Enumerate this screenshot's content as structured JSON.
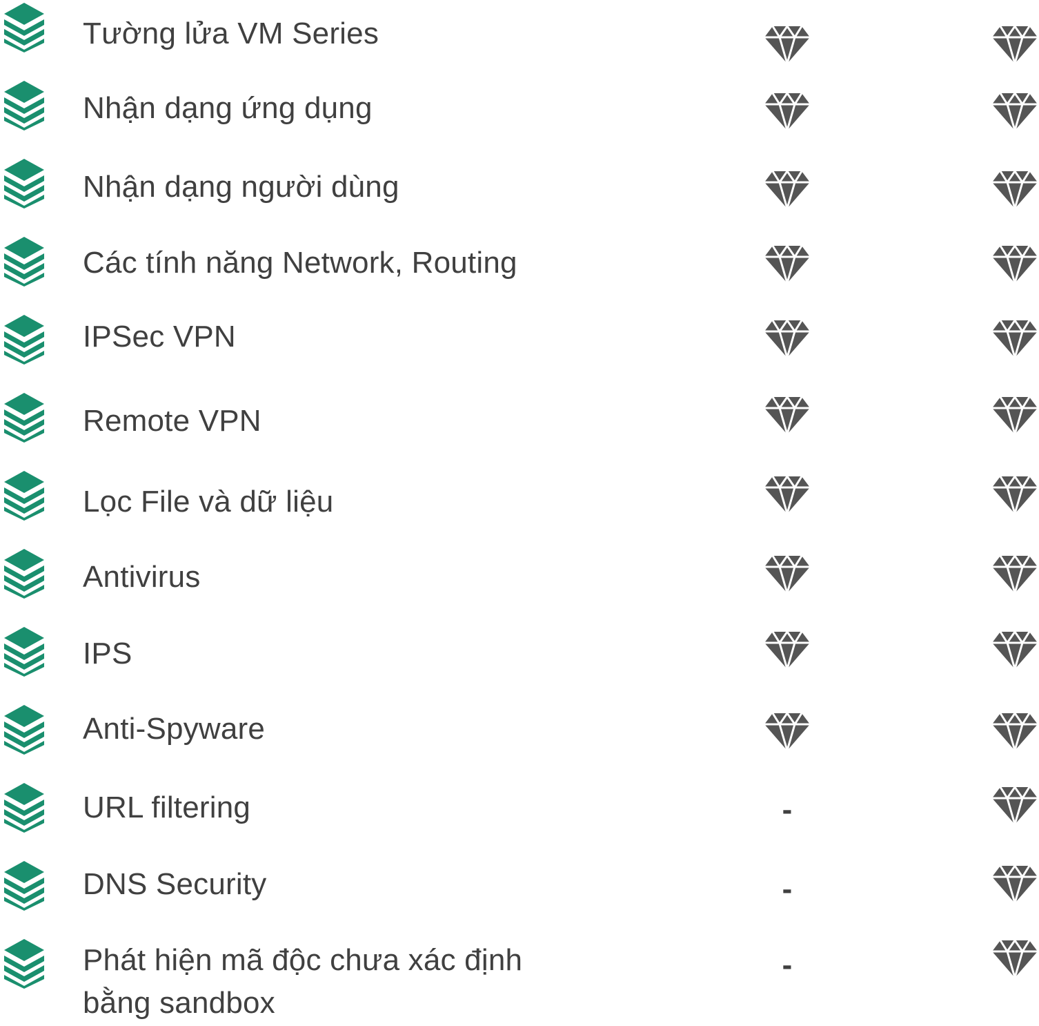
{
  "colors": {
    "icon_green": "#1a8f6e",
    "text": "#404040",
    "diamond": "#555555"
  },
  "icons": {
    "row_icon": "layers-icon",
    "included_icon": "diamond-icon"
  },
  "features": [
    {
      "label": "Tường lửa VM Series",
      "col1": "diamond",
      "col2": "diamond"
    },
    {
      "label": "Nhận dạng ứng dụng",
      "col1": "diamond",
      "col2": "diamond"
    },
    {
      "label": "Nhận dạng người dùng",
      "col1": "diamond",
      "col2": "diamond"
    },
    {
      "label": "Các tính năng Network, Routing",
      "col1": "diamond",
      "col2": "diamond"
    },
    {
      "label": "IPSec VPN",
      "col1": "diamond",
      "col2": "diamond"
    },
    {
      "label": "Remote VPN",
      "col1": "diamond",
      "col2": "diamond"
    },
    {
      "label": "Lọc File và dữ liệu",
      "col1": "diamond",
      "col2": "diamond"
    },
    {
      "label": "Antivirus",
      "col1": "diamond",
      "col2": "diamond"
    },
    {
      "label": "IPS",
      "col1": "diamond",
      "col2": "diamond"
    },
    {
      "label": "Anti-Spyware",
      "col1": "diamond",
      "col2": "diamond"
    },
    {
      "label": "URL filtering",
      "col1": "-",
      "col2": "diamond"
    },
    {
      "label": "DNS Security",
      "col1": "-",
      "col2": "diamond"
    },
    {
      "label": "Phát hiện mã độc chưa xác định bằng sandbox",
      "col1": "-",
      "col2": "diamond"
    }
  ]
}
